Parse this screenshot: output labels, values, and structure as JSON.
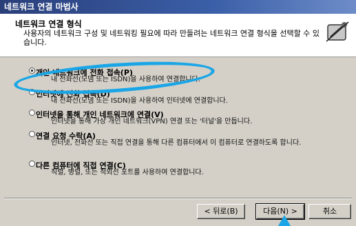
{
  "window": {
    "title": "네트워크 연결 마법사"
  },
  "header": {
    "title": "네트워크 연결 형식",
    "description": "사용자의 네트워크 구성 및 네트워킹 필요에 따라 만들려는 네트워크 연결 형식을 선택할 수 있습니다."
  },
  "options": [
    {
      "label": "개인 네트워크에 전화 접속(P)",
      "desc": "내 전화선(모뎀 또는 ISDN)을 사용하여 연결합니다.",
      "checked": true
    },
    {
      "label": "인터넷에 전화 접속(D)",
      "desc": "내 전화선(모뎀 또는 ISDN)을 사용하여 인터넷에 연결합니다.",
      "checked": false
    },
    {
      "label": "인터넷을 통해 개인 네트워크에 연결(V)",
      "desc": "인터넷을 통해 가상 개인 네트워크(VPN) 연결 또는 '터널'을 만듭니다.",
      "checked": false
    },
    {
      "label": "연결 요청 수락(A)",
      "desc": "인터넷, 전화선 또는 직접 연결을 통해 다른 컴퓨터에서 이 컴퓨터로 연결하도록 합니다.",
      "checked": false
    },
    {
      "label": "다른 컴퓨터에 직접 연결(C)",
      "desc": "직렬, 병렬, 또는 적외선 포트를 사용하여 연결합니다.",
      "checked": false
    }
  ],
  "buttons": {
    "back": "< 뒤로(B)",
    "next": "다음(N) >",
    "cancel": "취소"
  },
  "annotation_color": "#1aa6e6"
}
